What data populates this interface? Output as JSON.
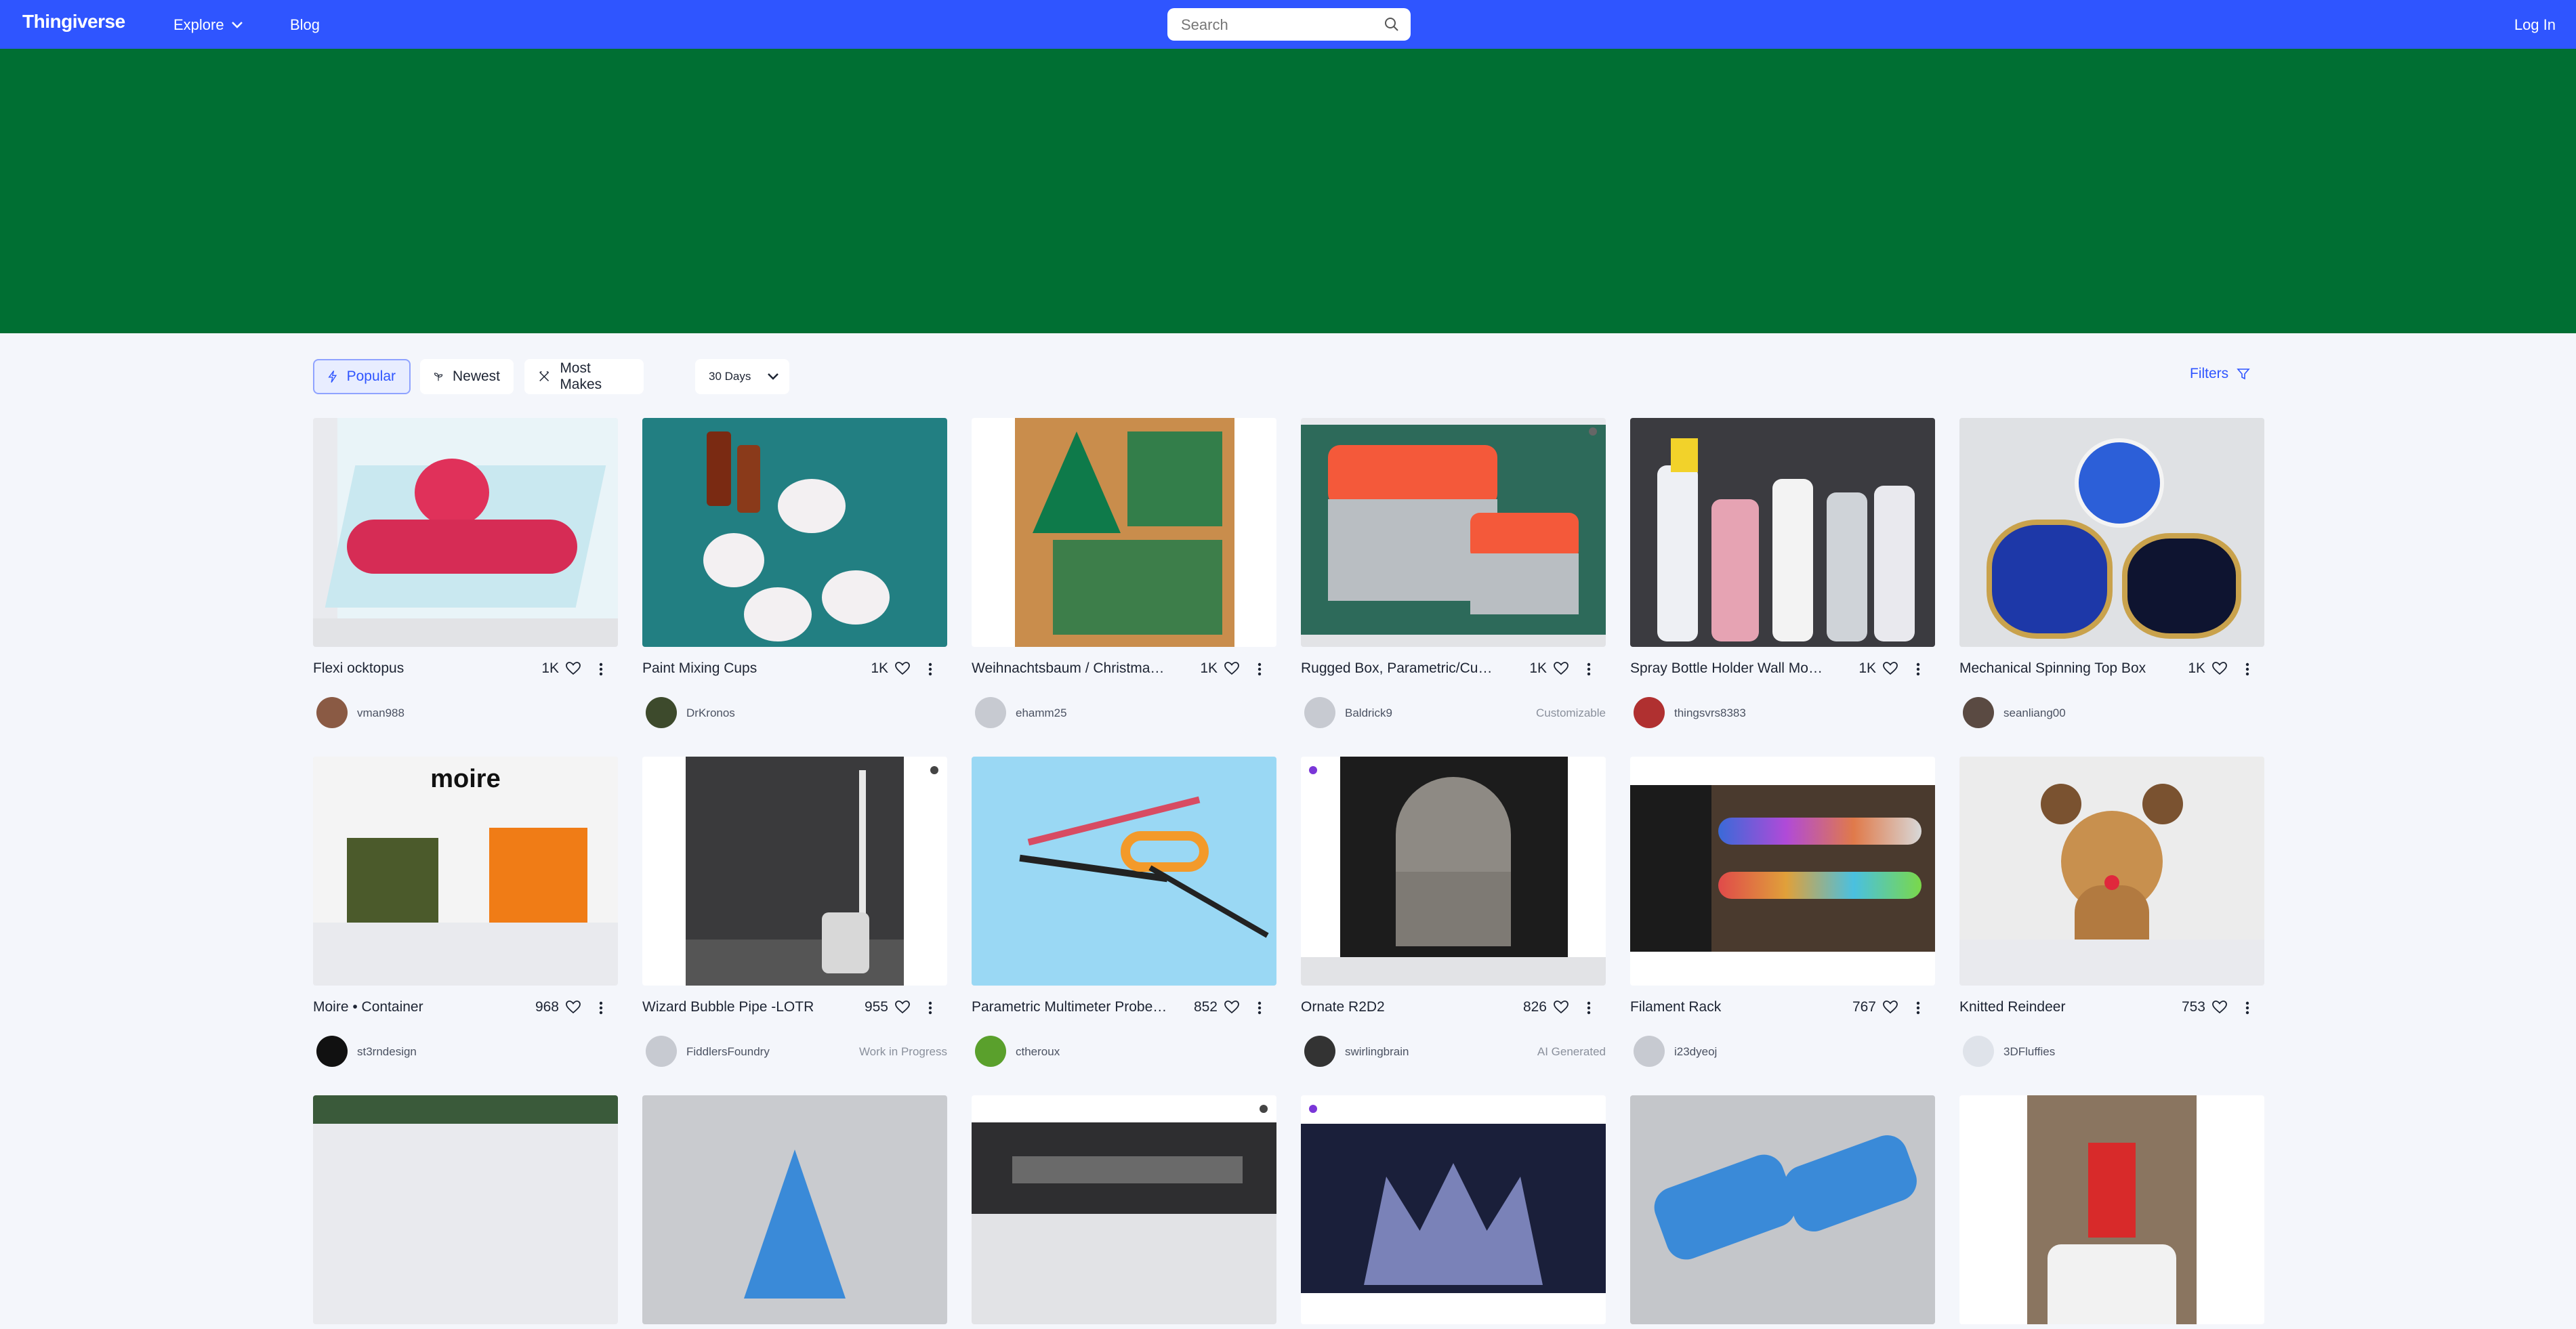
{
  "nav": {
    "logo": "Thingiverse",
    "explore_label": "Explore",
    "blog_label": "Blog",
    "search_placeholder": "Search",
    "login_label": "Log In"
  },
  "filterbar": {
    "tabs": [
      {
        "label": "Popular",
        "icon": "lightning-icon",
        "active": true
      },
      {
        "label": "Newest",
        "icon": "sprout-icon",
        "active": false
      },
      {
        "label": "Most Makes",
        "icon": "tools-icon",
        "active": false
      }
    ],
    "period": "30 Days",
    "filters_label": "Filters"
  },
  "colors": {
    "nav_bg": "#2f55ff",
    "hero_bg": "#006f33",
    "page_bg": "#f4f6fb",
    "accent": "#2f55ff"
  },
  "cards": [
    {
      "title": "Flexi ocktopus",
      "likes": "1K",
      "user": "vman988",
      "badge": ""
    },
    {
      "title": "Paint Mixing Cups",
      "likes": "1K",
      "user": "DrKronos",
      "badge": ""
    },
    {
      "title": "Weihnachtsbaum / Christmas Tree",
      "likes": "1K",
      "user": "ehamm25",
      "badge": ""
    },
    {
      "title": "Rugged Box, Parametric/Customizable",
      "likes": "1K",
      "user": "Baldrick9",
      "badge": "Customizable"
    },
    {
      "title": "Spray Bottle Holder Wall Mount",
      "likes": "1K",
      "user": "thingsvrs8383",
      "badge": ""
    },
    {
      "title": "Mechanical Spinning Top Box",
      "likes": "1K",
      "user": "seanliang00",
      "badge": ""
    },
    {
      "title": "Moire • Container",
      "likes": "968",
      "user": "st3rndesign",
      "badge": ""
    },
    {
      "title": "Wizard Bubble Pipe -LOTR",
      "likes": "955",
      "user": "FiddlersFoundry",
      "badge": "Work in Progress"
    },
    {
      "title": "Parametric Multimeter Probe Holder",
      "likes": "852",
      "user": "ctheroux",
      "badge": ""
    },
    {
      "title": "Ornate R2D2",
      "likes": "826",
      "user": "swirlingbrain",
      "badge": "AI Generated"
    },
    {
      "title": "Filament Rack",
      "likes": "767",
      "user": "i23dyeoj",
      "badge": ""
    },
    {
      "title": "Knitted Reindeer",
      "likes": "753",
      "user": "3DFluffies",
      "badge": ""
    }
  ]
}
